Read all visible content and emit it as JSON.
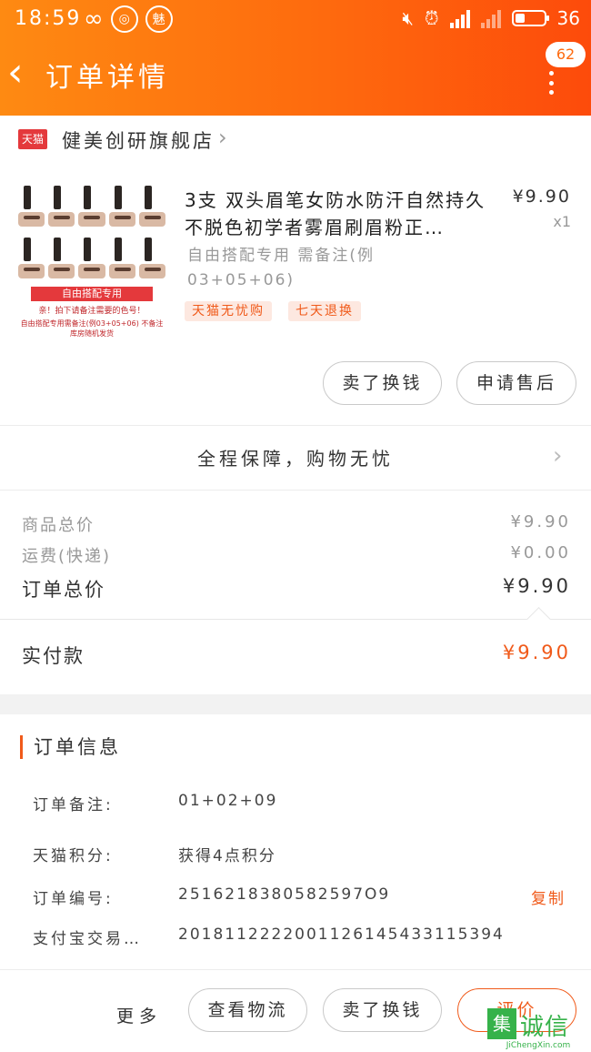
{
  "status_bar": {
    "time": "18:59",
    "icons": [
      "infinity-icon",
      "aperture-icon",
      "meizu-icon",
      "mute-icon",
      "alarm-icon",
      "signal-4g-icon",
      "signal-icon",
      "battery-icon"
    ],
    "meizu_glyph": "魅",
    "network_label": "4G",
    "battery_level": "36"
  },
  "header": {
    "back_icon": "back-arrow-icon",
    "title": "订单详情",
    "badge_count": "62",
    "menu_icon": "more-vertical-icon",
    "background_colors": [
      "#fe8a12",
      "#fd4b0b"
    ]
  },
  "store": {
    "logo_label": "天猫",
    "name": "健美创研旗舰店",
    "chevron_icon": "chevron-right-icon"
  },
  "product": {
    "image_promo_title": "自由搭配专用",
    "image_promo_sub": "亲！拍下请备注需要的色号！",
    "image_promo_small": "自由搭配专用需备注(例03+05+06) 不备注库房随机发货",
    "title": "3支 双头眉笔女防水防汗自然持久不脱色初学者雾眉刷眉粉正…",
    "price": "¥9.90",
    "quantity": "x1",
    "spec": "自由搭配专用 需备注(例03+05+06)",
    "tags": [
      "天猫无忧购",
      "七天退换"
    ],
    "buttons": {
      "buy_again": "卖了换钱",
      "after_sale": "申请售后"
    }
  },
  "guarantee": {
    "text": "全程保障，购物无忧",
    "chevron_icon": "chevron-right-icon"
  },
  "prices": {
    "goods_total_label": "商品总价",
    "goods_total_value": "¥9.90",
    "shipping_label": "运费(快递)",
    "shipping_value": "¥0.00",
    "order_total_label": "订单总价",
    "order_total_value": "¥9.90",
    "paid_label": "实付款",
    "paid_value": "¥9.90"
  },
  "order_info": {
    "section_title": "订单信息",
    "rows": [
      {
        "label": "订单备注:",
        "value": "01+02+09"
      },
      {
        "label": "天猫积分:",
        "value": "获得4点积分"
      },
      {
        "label": "订单编号:",
        "value": "2516218380582597O9"
      },
      {
        "label": "支付宝交易…",
        "value": "2018112222001126145433115394"
      }
    ],
    "copy_label": "复制"
  },
  "bottom_bar": {
    "more_label": "更多",
    "buttons": [
      "查看物流",
      "卖了换钱",
      "评价"
    ]
  },
  "watermark": {
    "logo_glyph": "集",
    "text": "诚信",
    "url": "JiChengXin.com"
  },
  "colors": {
    "accent": "#f05a1a",
    "tmall_red": "#e4393c",
    "watermark_green": "#36b24a"
  }
}
